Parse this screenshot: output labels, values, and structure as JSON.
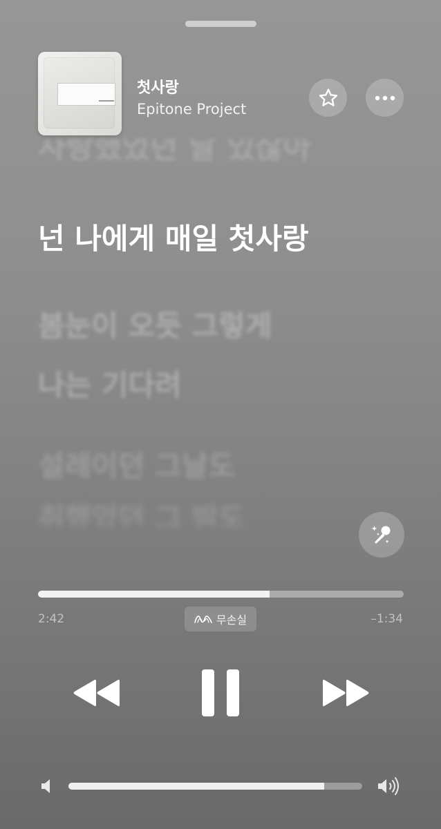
{
  "player": {
    "song_title": "첫사랑",
    "artist": "Epitone Project",
    "progress_fraction": 0.634,
    "elapsed": "2:42",
    "remaining": "–1:34",
    "quality_label": "무손실",
    "volume_fraction": 0.87
  },
  "lyrics": {
    "previous": "사랑했었던 날 있잖아",
    "current": "넌 나에게 매일 첫사랑",
    "upcoming": [
      "봄눈이 오듯 그렇게",
      "나는 기다려",
      "설레이던 그날도",
      "취했었던 그 밤도"
    ]
  },
  "icons": {
    "favorite": "star-outline-icon",
    "more": "ellipsis-icon",
    "lyrics_karaoke": "microphone-sparkles-icon",
    "lossless": "lossless-wave-icon",
    "rewind": "rewind-icon",
    "pause": "pause-icon",
    "forward": "fast-forward-icon",
    "volume_low": "speaker-low-icon",
    "volume_high": "speaker-high-icon"
  }
}
